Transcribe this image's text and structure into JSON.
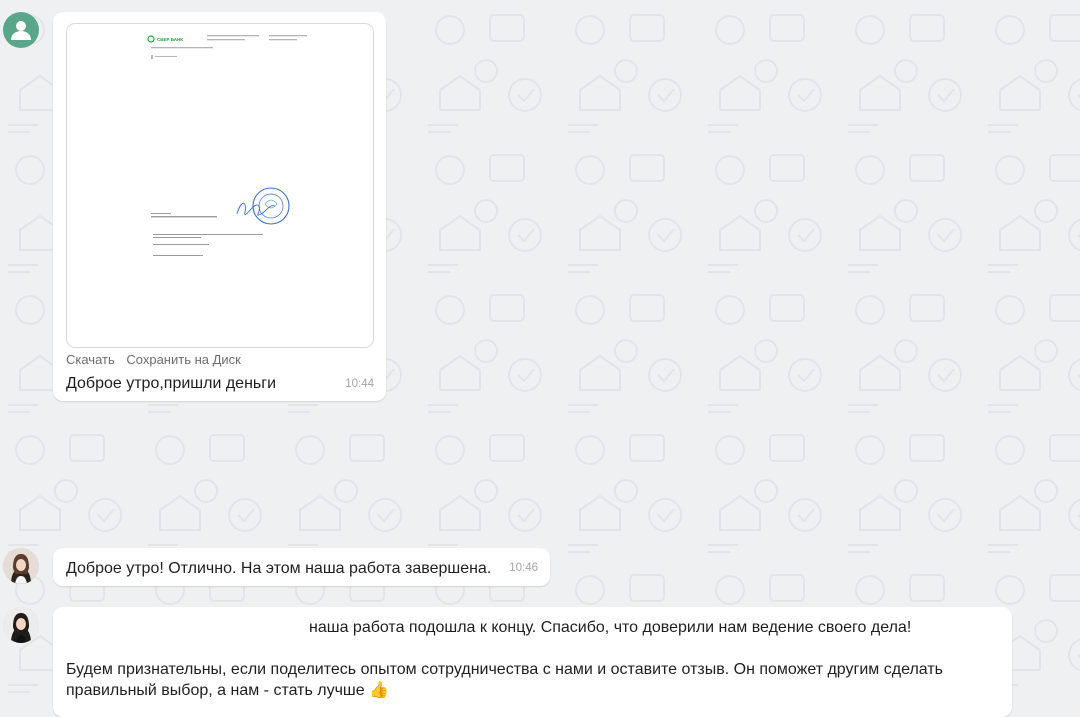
{
  "messages": [
    {
      "id": "m1",
      "sender": "contact-default",
      "attachment": {
        "type": "document-preview",
        "doc_brand": "СБЕР БАНК",
        "download_label": "Скачать",
        "save_to_disk_label": "Сохранить на Диск"
      },
      "text": "Доброе утро,пришли деньги",
      "time": "10:44"
    },
    {
      "id": "m2",
      "sender": "manager",
      "text": "Доброе утро! Отлично. На этом наша работа завершена.",
      "time": "10:46"
    },
    {
      "id": "m3",
      "sender": "manager",
      "text_line1": "наша работа подошла к концу. Спасибо, что доверили нам ведение своего дела!",
      "text_line2": "Будем признательны, если поделитесь опытом сотрудничества с нами и оставите отзыв. Он поможет другим сделать",
      "text_line3": "правильный выбор, а нам - стать лучше",
      "emoji": "👍"
    }
  ],
  "colors": {
    "background": "#eef0f1",
    "bubble": "#ffffff",
    "time": "#a4a4a4",
    "link": "#6c6c6c",
    "avatar_default": "#5aa68a",
    "sber_green": "#21a038"
  }
}
